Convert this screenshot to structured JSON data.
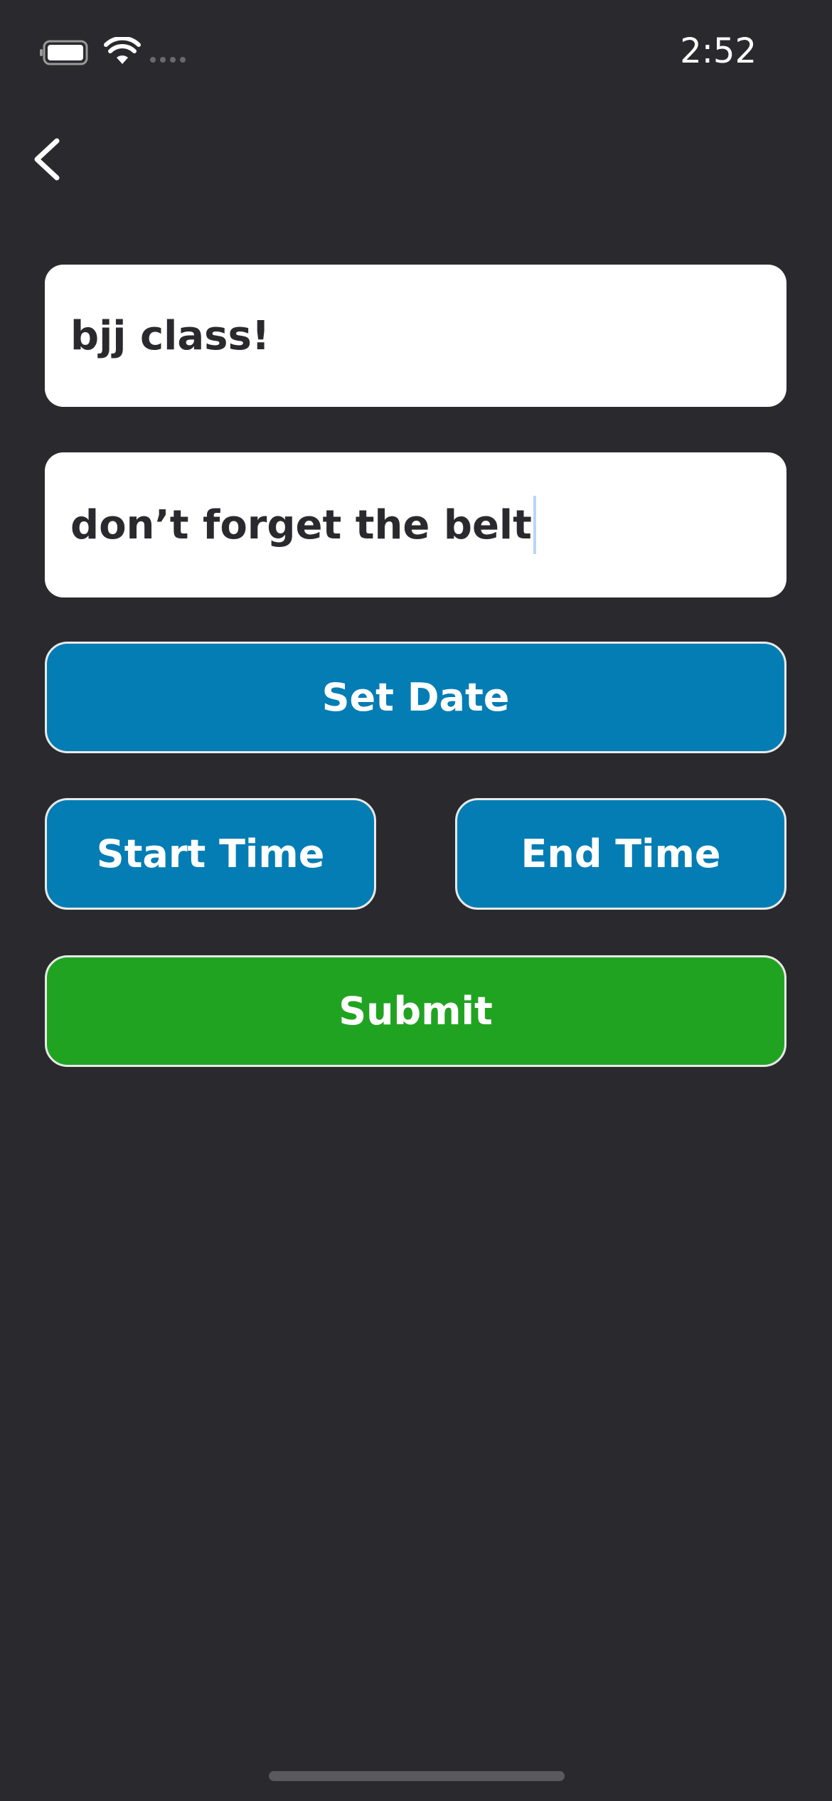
{
  "status_bar": {
    "time": "2:52",
    "battery_icon": "battery-icon",
    "wifi_icon": "wifi-icon",
    "signal_icon": "cellular-signal-icon"
  },
  "nav": {
    "back_icon": "chevron-left-icon"
  },
  "form": {
    "title_value": "bjj class!",
    "notes_value": "don’t forget the belt"
  },
  "buttons": {
    "set_date": "Set Date",
    "start_time": "Start Time",
    "end_time": "End Time",
    "submit": "Submit"
  },
  "colors": {
    "background": "#2a2a2e",
    "field_background": "#ffffff",
    "field_text": "#2a2a2e",
    "primary_button": "#037db4",
    "submit_button": "#21a322",
    "button_border": "#e9e9e9"
  }
}
